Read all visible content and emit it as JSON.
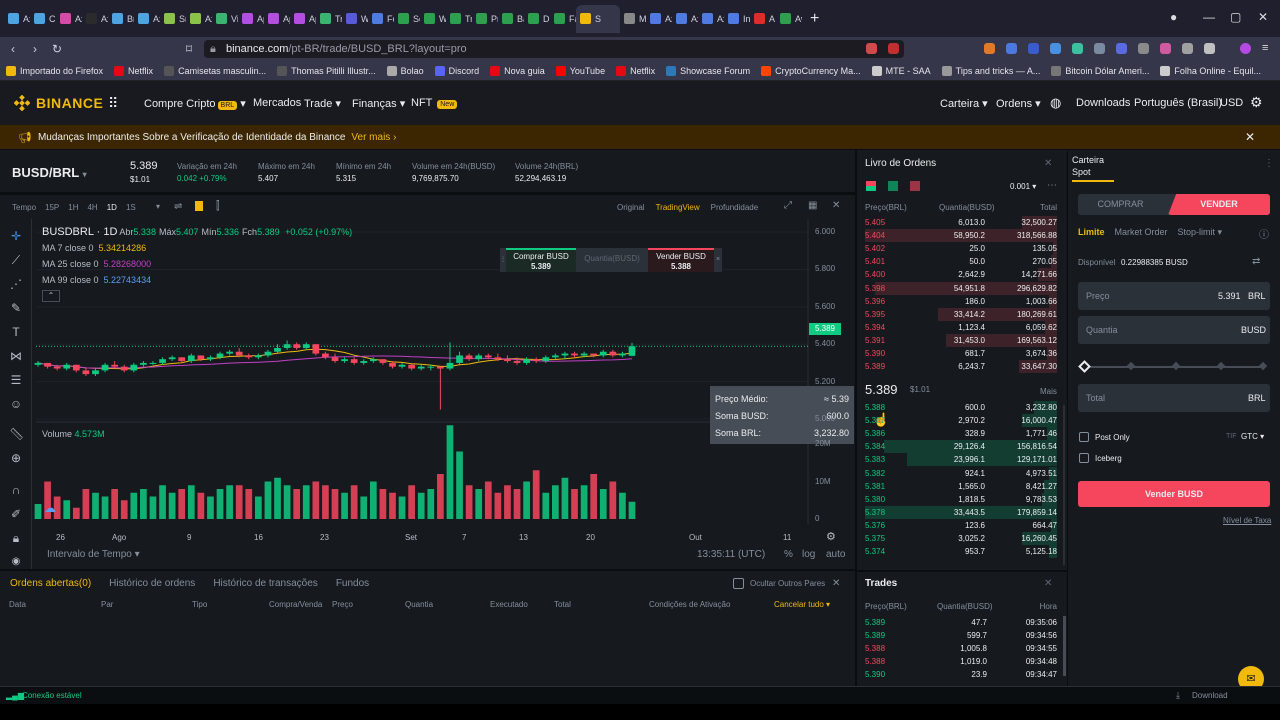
{
  "browser": {
    "tabs": [
      {
        "label": "Axie",
        "color": "#4fa3e0"
      },
      {
        "label": "Chil",
        "color": "#4fa3e0"
      },
      {
        "label": "Axie",
        "color": "#d84aa8"
      },
      {
        "label": "Axie",
        "color": "#2b2b2b"
      },
      {
        "label": "Bre",
        "color": "#4fa3e0"
      },
      {
        "label": "Axie",
        "color": "#4fa3e0"
      },
      {
        "label": "Smo",
        "color": "#8bc34a"
      },
      {
        "label": "Axie",
        "color": "#8bc34a"
      },
      {
        "label": "Vipc",
        "color": "#3cb371"
      },
      {
        "label": "Ape",
        "color": "#b34fe0"
      },
      {
        "label": "Ape",
        "color": "#b34fe0"
      },
      {
        "label": "Ape",
        "color": "#b34fe0"
      },
      {
        "label": "Tree",
        "color": "#3cb371"
      },
      {
        "label": "Wor",
        "color": "#5a5ad8"
      },
      {
        "label": "Folk",
        "color": "#4f7be0"
      },
      {
        "label": "Sch",
        "color": "#2e9e4f"
      },
      {
        "label": "Win",
        "color": "#2e9e4f"
      },
      {
        "label": "Tree",
        "color": "#2e9e4f"
      },
      {
        "label": "Pred",
        "color": "#2e9e4f"
      },
      {
        "label": "Barr",
        "color": "#2e9e4f"
      },
      {
        "label": "Dilu",
        "color": "#2e9e4f"
      },
      {
        "label": "Farn",
        "color": "#2e9e4f"
      },
      {
        "label": "S",
        "color": "#f0b90b",
        "active": true
      },
      {
        "label": "Mor",
        "color": "#888"
      },
      {
        "label": "Axie",
        "color": "#4f7be0"
      },
      {
        "label": "Axie",
        "color": "#4f7be0"
      },
      {
        "label": "Axie",
        "color": "#4f7be0"
      },
      {
        "label": "Inve",
        "color": "#4f7be0"
      },
      {
        "label": "A TI",
        "color": "#e02b2b"
      },
      {
        "label": "Aval",
        "color": "#2e9e4f"
      }
    ],
    "new_tab": "+",
    "url_domain": "binance.com",
    "url_path": "/pt-BR/trade/BUSD_BRL?layout=pro",
    "bookmarks": [
      {
        "label": "Importado do Firefox",
        "color": "#f0b90b"
      },
      {
        "label": "Netflix",
        "color": "#e50914"
      },
      {
        "label": "Camisetas masculin...",
        "color": "#555"
      },
      {
        "label": "Thomas Pitilli Illustr...",
        "color": "#555"
      },
      {
        "label": "Bolao",
        "color": "#aaa"
      },
      {
        "label": "Discord",
        "color": "#5865f2"
      },
      {
        "label": "Nova guia",
        "color": "#e50914"
      },
      {
        "label": "YouTube",
        "color": "#ff0000"
      },
      {
        "label": "Netflix",
        "color": "#e50914"
      },
      {
        "label": "Showcase Forum",
        "color": "#2a7ab9"
      },
      {
        "label": "CryptoCurrency Ma...",
        "color": "#ff4500"
      },
      {
        "label": "MTE - SAA",
        "color": "#ccc"
      },
      {
        "label": "Tips and tricks — A...",
        "color": "#999"
      },
      {
        "label": "Bitcoin Dólar Ameri...",
        "color": "#777"
      },
      {
        "label": "Folha Online - Equil...",
        "color": "#ccc"
      }
    ]
  },
  "header": {
    "logo": "BINANCE",
    "nav": {
      "buy": "Compre Cripto",
      "buy_badge": "BRL",
      "markets": "Mercados",
      "trade": "Trade",
      "finance": "Finanças",
      "nft": "NFT",
      "nft_badge": "New"
    },
    "right": {
      "wallet": "Carteira",
      "orders": "Ordens",
      "downloads": "Downloads",
      "language": "Português (Brasil)",
      "currency": "USD"
    }
  },
  "notice": {
    "text": "Mudanças Importantes Sobre a Verificação de Identidade da Binance",
    "more": "Ver mais"
  },
  "market": {
    "pair": "BUSD/BRL",
    "price": "5.389",
    "price_usd": "$1.01",
    "stats": [
      {
        "label": "Variação em 24h",
        "value": "0.042 +0.79%",
        "color": "#0ecb81"
      },
      {
        "label": "Máximo em 24h",
        "value": "5.407",
        "color": "#eaecef"
      },
      {
        "label": "Mínimo em 24h",
        "value": "5.315",
        "color": "#eaecef"
      },
      {
        "label": "Volume em 24h(BUSD)",
        "value": "9,769,875.70",
        "color": "#eaecef"
      },
      {
        "label": "Volume 24h(BRL)",
        "value": "52,294,463.19",
        "color": "#eaecef"
      }
    ]
  },
  "toolbar": {
    "intervals": [
      "Tempo",
      "15P",
      "1H",
      "4H",
      "1D",
      "1S"
    ],
    "active_interval": "1D",
    "views": [
      "Original",
      "TradingView",
      "Profundidade"
    ],
    "active_view": "TradingView"
  },
  "chart": {
    "legend_title": "BUSDBRL · 1D",
    "ohlc": [
      {
        "k": "Abr",
        "v": "5.338"
      },
      {
        "k": "Máx",
        "v": "5.407"
      },
      {
        "k": "Mín",
        "v": "5.336"
      },
      {
        "k": "Fch",
        "v": "5.389"
      }
    ],
    "change": "+0.052 (+0.97%)",
    "ma": [
      {
        "label": "MA 7 close 0",
        "value": "5.34214286",
        "color": "#f0b90b"
      },
      {
        "label": "MA 25 close 0",
        "value": "5.28268000",
        "color": "#c33fc9"
      },
      {
        "label": "MA 99 close 0",
        "value": "5.22743434",
        "color": "#5b9cf6"
      }
    ],
    "volume_label": "Volume",
    "volume_value": "4.573M",
    "y_ticks": [
      "6.000",
      "5.800",
      "5.600",
      "5.400",
      "5.200",
      "5.000"
    ],
    "vol_ticks": [
      "20M",
      "10M",
      "0"
    ],
    "last_price": "5.389",
    "x_ticks": [
      "26",
      "Ago",
      "9",
      "16",
      "23",
      "Set",
      "7",
      "13",
      "20",
      "Out",
      "11"
    ],
    "buy_btn": {
      "label": "Comprar BUSD",
      "price": "5.389"
    },
    "qty_placeholder": "Quantia(BUSD)",
    "sell_btn": {
      "label": "Vender BUSD",
      "price": "5.388"
    },
    "tooltip": [
      {
        "k": "Preço Médio:",
        "v": "≈ 5.39"
      },
      {
        "k": "Soma BUSD:",
        "v": "600.0"
      },
      {
        "k": "Soma BRL:",
        "v": "3,232.80"
      }
    ],
    "bottom": {
      "interval": "Intervalo de Tempo",
      "time": "13:35:11 (UTC)",
      "pct": "%",
      "log": "log",
      "auto": "auto"
    }
  },
  "chart_data": {
    "type": "candlestick",
    "ylim": [
      5.0,
      6.07
    ],
    "candles": [
      [
        5.29,
        5.31,
        5.28,
        5.3
      ],
      [
        5.3,
        5.3,
        5.27,
        5.28
      ],
      [
        5.28,
        5.29,
        5.26,
        5.27
      ],
      [
        5.27,
        5.3,
        5.26,
        5.29
      ],
      [
        5.29,
        5.29,
        5.25,
        5.26
      ],
      [
        5.26,
        5.27,
        5.23,
        5.24
      ],
      [
        5.24,
        5.27,
        5.23,
        5.26
      ],
      [
        5.26,
        5.3,
        5.25,
        5.29
      ],
      [
        5.29,
        5.31,
        5.27,
        5.28
      ],
      [
        5.28,
        5.29,
        5.25,
        5.26
      ],
      [
        5.26,
        5.3,
        5.25,
        5.29
      ],
      [
        5.29,
        5.31,
        5.28,
        5.3
      ],
      [
        5.3,
        5.31,
        5.29,
        5.3
      ],
      [
        5.3,
        5.33,
        5.29,
        5.32
      ],
      [
        5.32,
        5.34,
        5.31,
        5.33
      ],
      [
        5.33,
        5.33,
        5.3,
        5.31
      ],
      [
        5.31,
        5.35,
        5.3,
        5.34
      ],
      [
        5.34,
        5.34,
        5.31,
        5.32
      ],
      [
        5.32,
        5.34,
        5.31,
        5.33
      ],
      [
        5.33,
        5.36,
        5.32,
        5.35
      ],
      [
        5.35,
        5.37,
        5.34,
        5.36
      ],
      [
        5.36,
        5.38,
        5.33,
        5.34
      ],
      [
        5.34,
        5.35,
        5.32,
        5.33
      ],
      [
        5.33,
        5.35,
        5.32,
        5.34
      ],
      [
        5.34,
        5.37,
        5.33,
        5.36
      ],
      [
        5.36,
        5.4,
        5.35,
        5.38
      ],
      [
        5.38,
        5.42,
        5.37,
        5.4
      ],
      [
        5.4,
        5.41,
        5.37,
        5.38
      ],
      [
        5.38,
        5.41,
        5.37,
        5.4
      ],
      [
        5.4,
        5.4,
        5.34,
        5.35
      ],
      [
        5.35,
        5.36,
        5.32,
        5.33
      ],
      [
        5.33,
        5.35,
        5.3,
        5.31
      ],
      [
        5.31,
        5.33,
        5.3,
        5.32
      ],
      [
        5.32,
        5.33,
        5.29,
        5.3
      ],
      [
        5.3,
        5.32,
        5.29,
        5.31
      ],
      [
        5.31,
        5.33,
        5.3,
        5.32
      ],
      [
        5.32,
        5.32,
        5.29,
        5.3
      ],
      [
        5.3,
        5.31,
        5.27,
        5.28
      ],
      [
        5.28,
        5.3,
        5.27,
        5.29
      ],
      [
        5.29,
        5.3,
        5.26,
        5.27
      ],
      [
        5.27,
        5.29,
        5.26,
        5.28
      ],
      [
        5.28,
        5.29,
        5.26,
        5.28
      ],
      [
        5.28,
        5.28,
        5.05,
        5.27
      ],
      [
        5.27,
        5.41,
        5.26,
        5.3
      ],
      [
        5.3,
        5.36,
        5.29,
        5.34
      ],
      [
        5.34,
        5.35,
        5.31,
        5.32
      ],
      [
        5.32,
        5.35,
        5.31,
        5.34
      ],
      [
        5.34,
        5.35,
        5.32,
        5.33
      ],
      [
        5.33,
        5.35,
        5.31,
        5.32
      ],
      [
        5.32,
        5.34,
        5.3,
        5.31
      ],
      [
        5.31,
        5.33,
        5.29,
        5.3
      ],
      [
        5.3,
        5.33,
        5.29,
        5.32
      ],
      [
        5.32,
        5.33,
        5.3,
        5.31
      ],
      [
        5.31,
        5.34,
        5.3,
        5.33
      ],
      [
        5.33,
        5.35,
        5.32,
        5.34
      ],
      [
        5.34,
        5.36,
        5.32,
        5.35
      ],
      [
        5.35,
        5.36,
        5.33,
        5.34
      ],
      [
        5.34,
        5.36,
        5.33,
        5.35
      ],
      [
        5.35,
        5.35,
        5.33,
        5.34
      ],
      [
        5.34,
        5.37,
        5.33,
        5.36
      ],
      [
        5.36,
        5.37,
        5.33,
        5.34
      ],
      [
        5.34,
        5.36,
        5.33,
        5.35
      ],
      [
        5.338,
        5.407,
        5.336,
        5.389
      ]
    ],
    "volume_max": 24,
    "volume": [
      4,
      10,
      6,
      5,
      3,
      8,
      7,
      6,
      8,
      5,
      7,
      8,
      6,
      9,
      7,
      8,
      9,
      7,
      6,
      8,
      9,
      9,
      8,
      6,
      10,
      11,
      9,
      8,
      9,
      10,
      9,
      8,
      7,
      9,
      6,
      10,
      8,
      7,
      6,
      9,
      7,
      8,
      12,
      25,
      18,
      9,
      8,
      10,
      7,
      9,
      8,
      10,
      13,
      7,
      9,
      11,
      8,
      9,
      12,
      8,
      10,
      7,
      4.6
    ]
  },
  "orderbook": {
    "title": "Livro de Ordens",
    "precision": "0.001",
    "cols": [
      "Preço(BRL)",
      "Quantia(BUSD)",
      "Total"
    ],
    "asks": [
      {
        "p": "5.405",
        "q": "6,013.0",
        "t": "32,500.27",
        "d": 0.18
      },
      {
        "p": "5.404",
        "q": "58,950.2",
        "t": "318,566.88",
        "d": 1
      },
      {
        "p": "5.402",
        "q": "25.0",
        "t": "135.05",
        "d": 0.02
      },
      {
        "p": "5.401",
        "q": "50.0",
        "t": "270.05",
        "d": 0.03
      },
      {
        "p": "5.400",
        "q": "2,642.9",
        "t": "14,271.66",
        "d": 0.1
      },
      {
        "p": "5.398",
        "q": "54,951.8",
        "t": "296,629.82",
        "d": 0.95
      },
      {
        "p": "5.396",
        "q": "186.0",
        "t": "1,003.66",
        "d": 0.04
      },
      {
        "p": "5.395",
        "q": "33,414.2",
        "t": "180,269.61",
        "d": 0.62
      },
      {
        "p": "5.394",
        "q": "1,123.4",
        "t": "6,059.62",
        "d": 0.06
      },
      {
        "p": "5.391",
        "q": "31,453.0",
        "t": "169,563.12",
        "d": 0.58
      },
      {
        "p": "5.390",
        "q": "681.7",
        "t": "3,674.36",
        "d": 0.05
      },
      {
        "p": "5.389",
        "q": "6,243.7",
        "t": "33,647.30",
        "d": 0.2
      }
    ],
    "mid_price": "5.389",
    "mid_usd": "$1.01",
    "more": "Mais",
    "bids": [
      {
        "p": "5.388",
        "q": "600.0",
        "t": "3,232.80",
        "d": 0.12
      },
      {
        "p": "5.387",
        "q": "2,970.2",
        "t": "16,000.47",
        "d": 0.18
      },
      {
        "p": "5.386",
        "q": "328.9",
        "t": "1,771.46",
        "d": 0.05
      },
      {
        "p": "5.384",
        "q": "29,126.4",
        "t": "156,816.54",
        "d": 0.9
      },
      {
        "p": "5.383",
        "q": "23,996.1",
        "t": "129,171.01",
        "d": 0.78
      },
      {
        "p": "5.382",
        "q": "924.1",
        "t": "4,973.51",
        "d": 0.04
      },
      {
        "p": "5.381",
        "q": "1,565.0",
        "t": "8,421.27",
        "d": 0.07
      },
      {
        "p": "5.380",
        "q": "1,818.5",
        "t": "9,783.53",
        "d": 0.08
      },
      {
        "p": "5.378",
        "q": "33,443.5",
        "t": "179,859.14",
        "d": 1
      },
      {
        "p": "5.376",
        "q": "123.6",
        "t": "664.47",
        "d": 0.03
      },
      {
        "p": "5.375",
        "q": "3,025.2",
        "t": "16,260.45",
        "d": 0.18
      },
      {
        "p": "5.374",
        "q": "953.7",
        "t": "5,125.18",
        "d": 0.04
      }
    ]
  },
  "trades": {
    "title": "Trades",
    "cols": [
      "Preço(BRL)",
      "Quantia(BUSD)",
      "Hora"
    ],
    "rows": [
      {
        "p": "5.389",
        "q": "47.7",
        "t": "09:35:06",
        "c": "#0ecb81"
      },
      {
        "p": "5.389",
        "q": "599.7",
        "t": "09:34:56",
        "c": "#0ecb81"
      },
      {
        "p": "5.388",
        "q": "1,005.8",
        "t": "09:34:55",
        "c": "#f6465d"
      },
      {
        "p": "5.388",
        "q": "1,019.0",
        "t": "09:34:48",
        "c": "#f6465d"
      },
      {
        "p": "5.390",
        "q": "23.9",
        "t": "09:34:47",
        "c": "#0ecb81"
      }
    ]
  },
  "orders": {
    "tabs": [
      "Ordens abertas(0)",
      "Histórico de ordens",
      "Histórico de transações",
      "Fundos"
    ],
    "hide_pairs": "Ocultar Outros Pares",
    "cols": [
      "Data",
      "Par",
      "Tipo",
      "Compra/Venda",
      "Preço",
      "Quantia",
      "Executado",
      "Total",
      "Condições de Ativação"
    ],
    "cancel_all": "Cancelar tudo"
  },
  "spot": {
    "title": "Carteira Spot",
    "buy": "COMPRAR",
    "sell": "VENDER",
    "order_types": [
      "Limite",
      "Market Order",
      "Stop-limit"
    ],
    "available_label": "Disponível",
    "available_value": "0.22988385 BUSD",
    "price_label": "Preço",
    "price_value": "5.391",
    "price_unit": "BRL",
    "qty_label": "Quantia",
    "qty_unit": "BUSD",
    "total_label": "Total",
    "total_unit": "BRL",
    "post_only": "Post Only",
    "tif_prefix": "TIF",
    "tif": "GTC",
    "iceberg": "Iceberg",
    "submit": "Vender BUSD",
    "fee_link": "Nível de Taxa"
  },
  "status": {
    "connection": "Conexão estável",
    "download": "Download"
  }
}
